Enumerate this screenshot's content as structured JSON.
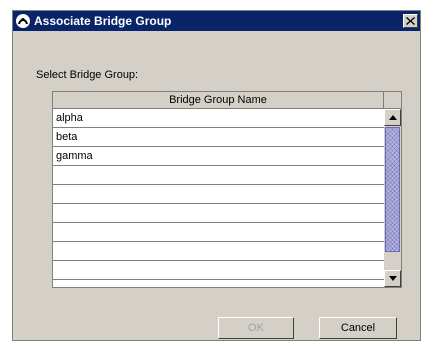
{
  "window": {
    "title": "Associate Bridge Group",
    "close_glyph": "×",
    "icon": "app-icon"
  },
  "prompt": "Select Bridge Group:",
  "table": {
    "column_header": "Bridge Group Name",
    "rows": [
      "alpha",
      "beta",
      "gamma",
      "",
      "",
      "",
      "",
      "",
      ""
    ]
  },
  "buttons": {
    "ok_label": "OK",
    "ok_enabled": false,
    "cancel_label": "Cancel"
  },
  "colors": {
    "titlebar": "#0a246a",
    "dialog_bg": "#d4d0c8",
    "scroll_thumb": "#b7b7e3"
  }
}
